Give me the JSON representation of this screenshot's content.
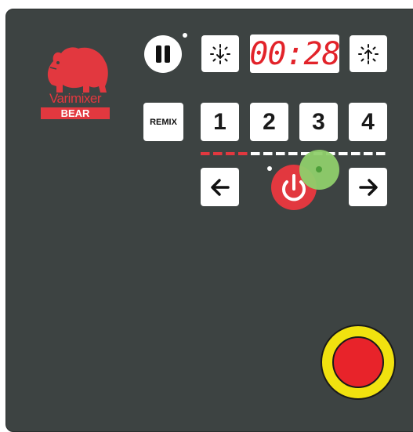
{
  "brand": {
    "name": "Varimixer",
    "sub": "BEAR",
    "logo_icon": "bear-icon",
    "color": "#e2383f"
  },
  "timer": {
    "display": "00:28",
    "decrease_icon": "timer-decrease-icon",
    "increase_icon": "timer-increase-icon"
  },
  "controls": {
    "pause_icon": "pause-icon",
    "remix_label": "REMIX",
    "speeds": [
      "1",
      "2",
      "3",
      "4"
    ],
    "left_icon": "arrow-left-icon",
    "right_icon": "arrow-right-icon",
    "power_icon": "power-icon"
  },
  "progress": {
    "segments_total": 15,
    "segments_filled": 4,
    "filled_color": "#e2383f",
    "empty_color": "#ffffff"
  },
  "emergency_stop": {
    "ring_color": "#f1e20f",
    "button_color": "#e8232a"
  },
  "colors": {
    "panel": "#3d4342",
    "indicator_green": "#8fcf6b"
  }
}
